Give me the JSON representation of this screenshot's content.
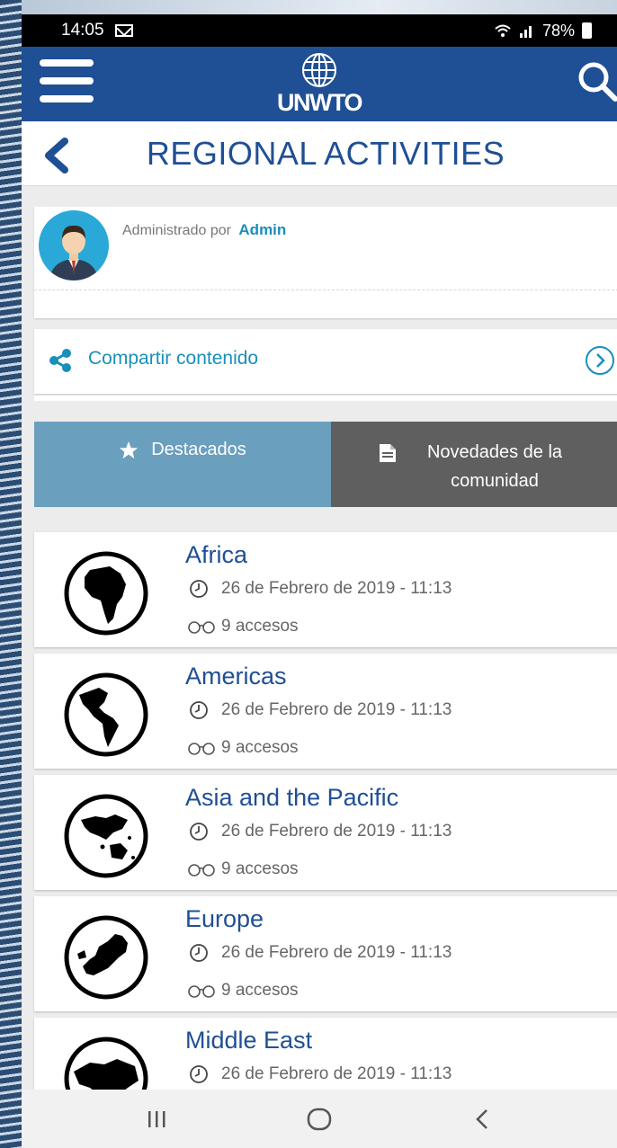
{
  "status_bar": {
    "time": "14:05",
    "battery": "78%"
  },
  "app_bar": {
    "logo_text": "UNWTO",
    "brand_color": "#1f4f94"
  },
  "title_bar": {
    "title": "REGIONAL ACTIVITIES"
  },
  "admin": {
    "prefix": "Administrado por",
    "name": "Admin"
  },
  "share": {
    "label": "Compartir contenido"
  },
  "tabs": [
    {
      "label": "Destacados",
      "icon": "star-icon",
      "active": true
    },
    {
      "label": "Novedades de la comunidad",
      "icon": "document-icon",
      "active": false
    }
  ],
  "items": [
    {
      "title": "Africa",
      "date": "26 de Febrero de 2019 - 11:13",
      "views": "9 accesos",
      "icon": "africa-globe-icon"
    },
    {
      "title": "Americas",
      "date": "26 de Febrero de 2019 - 11:13",
      "views": "9 accesos",
      "icon": "americas-globe-icon"
    },
    {
      "title": "Asia and the Pacific",
      "date": "26 de Febrero de 2019 - 11:13",
      "views": "9 accesos",
      "icon": "asia-pacific-globe-icon"
    },
    {
      "title": "Europe",
      "date": "26 de Febrero de 2019 - 11:13",
      "views": "9 accesos",
      "icon": "europe-globe-icon"
    },
    {
      "title": "Middle East",
      "date": "26 de Febrero de 2019 - 11:13",
      "views": "",
      "icon": "middle-east-globe-icon"
    }
  ],
  "accent_color": "#1a8fb8"
}
